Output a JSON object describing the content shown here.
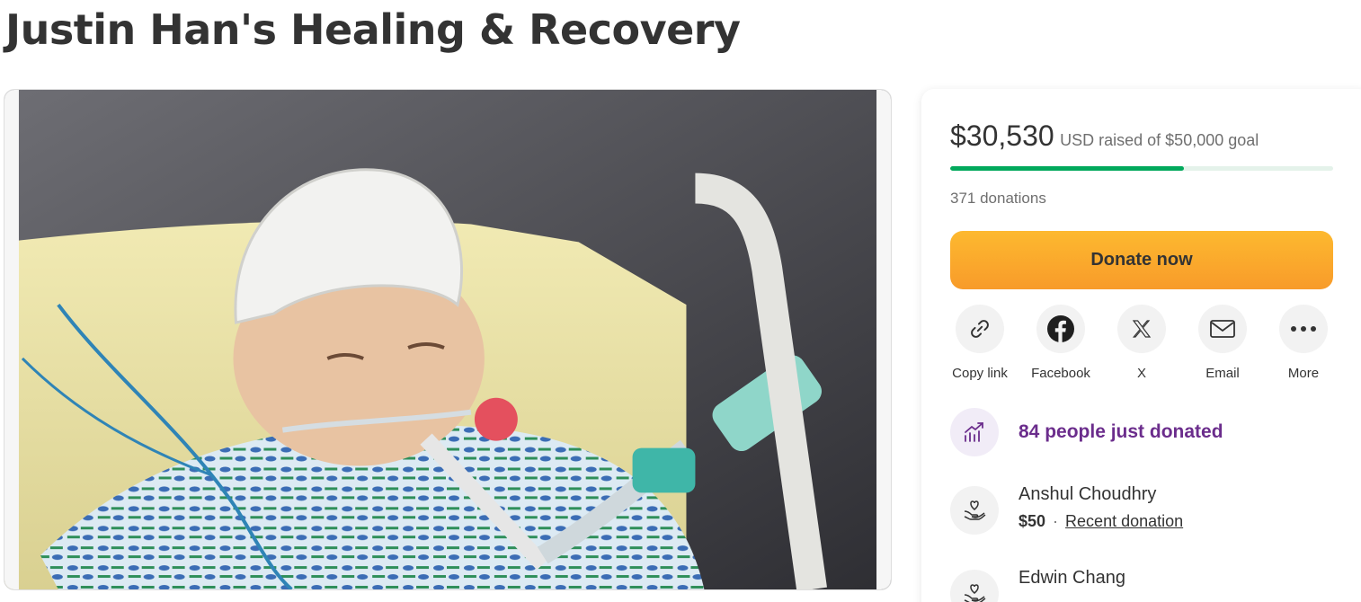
{
  "campaign": {
    "title": "Justin Han's Healing & Recovery"
  },
  "media": {
    "alt": "Justin Han's Healing & Recovery",
    "accent_colors": [
      "#f0e6a8",
      "#cfe6f2",
      "#3fb6a8"
    ]
  },
  "fundraising": {
    "amount_raised": "$30,530",
    "goal_text": "USD raised of $50,000 goal",
    "progress_fraction": 0.6106,
    "donations_count": "371 donations",
    "progress_color": "#02a95c",
    "progress_track_color": "#e4f2ea"
  },
  "donate_button": {
    "label": "Donate now",
    "gradient": [
      "#fdb92f",
      "#f89b2a"
    ]
  },
  "share": [
    {
      "label": "Copy link",
      "icon": "link-icon"
    },
    {
      "label": "Facebook",
      "icon": "facebook-icon"
    },
    {
      "label": "X",
      "icon": "x-logo-icon"
    },
    {
      "label": "Email",
      "icon": "envelope-icon"
    },
    {
      "label": "More",
      "icon": "more-dots-icon"
    }
  ],
  "trending": {
    "text": "84 people just donated",
    "icon": "trending-up-icon",
    "color": "#6b2d8c"
  },
  "donors": [
    {
      "name": "Anshul Choudhry",
      "amount": "$50",
      "separator": "·",
      "label": "Recent donation",
      "icon": "heart-hands-icon"
    },
    {
      "name": "Edwin Chang",
      "amount": "",
      "separator": "",
      "label": "",
      "icon": "heart-hands-icon"
    }
  ]
}
